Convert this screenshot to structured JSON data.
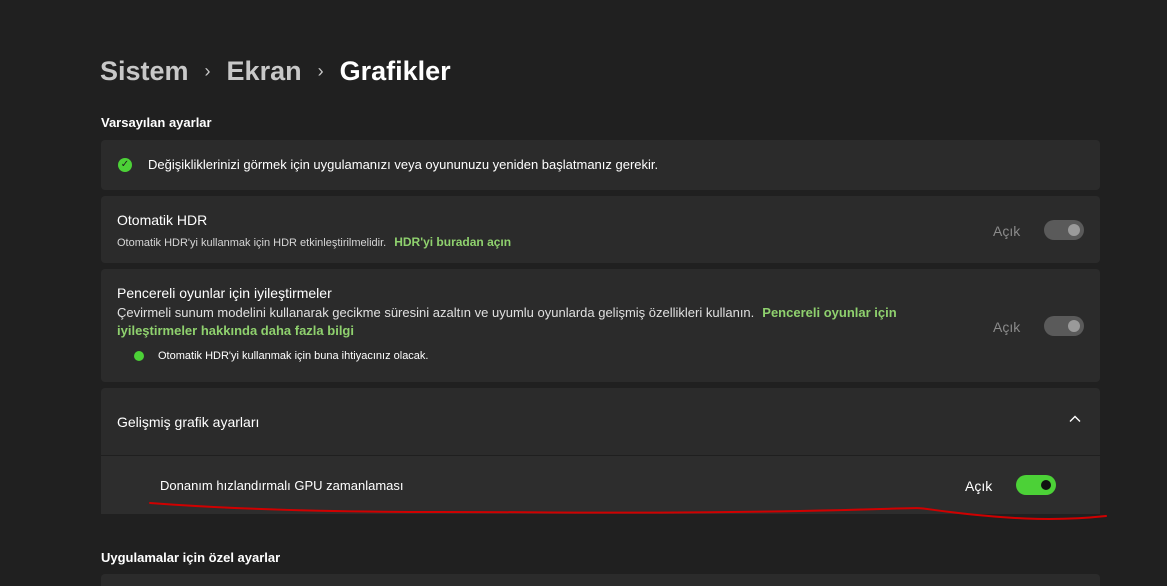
{
  "breadcrumb": {
    "items": [
      "Sistem",
      "Ekran",
      "Grafikler"
    ],
    "separator": "›"
  },
  "default_section": {
    "title": "Varsayılan ayarlar",
    "info_text": "Değişikliklerinizi görmek için uygulamanızı veya oyununuzu yeniden başlatmanız gerekir."
  },
  "auto_hdr": {
    "title": "Otomatik HDR",
    "description": "Otomatik HDR'yi kullanmak için HDR etkinleştirilmelidir.",
    "link": "HDR'yi buradan açın",
    "state": "Açık",
    "enabled": false
  },
  "windowed_games": {
    "title": "Pencereli oyunlar için iyileştirmeler",
    "description": "Çevirmeli sunum modelini kullanarak gecikme süresini azaltın ve uyumlu oyunlarda gelişmiş özellikleri kullanın.",
    "link": "Pencereli oyunlar için iyileştirmeler hakkında daha fazla bilgi",
    "note": "Otomatik HDR'yi kullanmak için buna ihtiyacınız olacak.",
    "state": "Açık",
    "enabled": false
  },
  "advanced": {
    "title": "Gelişmiş grafik ayarları",
    "expanded": true,
    "gpu_scheduling": {
      "label": "Donanım hızlandırmalı GPU zamanlaması",
      "state": "Açık",
      "on": true
    }
  },
  "app_section": {
    "title": "Uygulamalar için özel ayarlar"
  },
  "icons": {
    "info": "info-check-icon",
    "chevron": "chevron-up-icon"
  },
  "colors": {
    "accent": "#4cd137",
    "link": "#8fd16e",
    "background": "#202020",
    "card": "#2b2b2b",
    "annotation": "#d00000"
  }
}
